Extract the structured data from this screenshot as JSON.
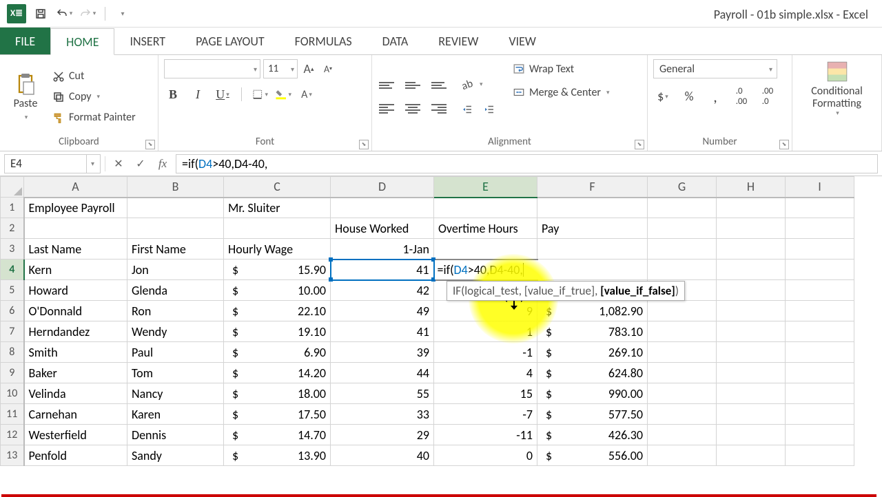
{
  "window_title": "Payroll - 01b simple.xlsx - Excel",
  "qat": {
    "excel": "X≣"
  },
  "tabs": {
    "file": "FILE",
    "home": "HOME",
    "insert": "INSERT",
    "page_layout": "PAGE LAYOUT",
    "formulas": "FORMULAS",
    "data": "DATA",
    "review": "REVIEW",
    "view": "VIEW"
  },
  "ribbon": {
    "clipboard": {
      "label": "Clipboard",
      "paste": "Paste",
      "cut": "Cut",
      "copy": "Copy",
      "format_painter": "Format Painter"
    },
    "font": {
      "label": "Font",
      "size": "11"
    },
    "alignment": {
      "label": "Alignment",
      "wrap": "Wrap Text",
      "merge": "Merge & Center"
    },
    "number": {
      "label": "Number",
      "format": "General"
    },
    "cond": "Conditional Formatting"
  },
  "name_box": "E4",
  "formula_prefix": "=if(",
  "formula_ref": "D4",
  "formula_rest": ">40,D4-40,",
  "tooltip": {
    "fn": "IF",
    "a1": "logical_test",
    "a2": "[value_if_true]",
    "a3": "[value_if_false]"
  },
  "columns": [
    "A",
    "B",
    "C",
    "D",
    "E",
    "F",
    "G",
    "H",
    "I"
  ],
  "headers": {
    "r1": {
      "A": "Employee Payroll",
      "C": "Mr. Sluiter"
    },
    "r2": {
      "D": "House Worked",
      "E": "Overtime Hours",
      "F": "Pay"
    },
    "r3": {
      "A": "Last Name",
      "B": "First Name",
      "C": "Hourly Wage",
      "D": "1-Jan"
    }
  },
  "rows": [
    {
      "n": 4,
      "last": "Kern",
      "first": "Jon",
      "wage": "15.90",
      "hours": "41",
      "ot": "",
      "pay": ""
    },
    {
      "n": 5,
      "last": "Howard",
      "first": "Glenda",
      "wage": "10.00",
      "hours": "42",
      "ot": "",
      "pay": ""
    },
    {
      "n": 6,
      "last": "O'Donnald",
      "first": "Ron",
      "wage": "22.10",
      "hours": "49",
      "ot": "9",
      "pay": "1,082.90"
    },
    {
      "n": 7,
      "last": "Herndandez",
      "first": "Wendy",
      "wage": "19.10",
      "hours": "41",
      "ot": "1",
      "pay": "783.10"
    },
    {
      "n": 8,
      "last": "Smith",
      "first": "Paul",
      "wage": "6.90",
      "hours": "39",
      "ot": "-1",
      "pay": "269.10"
    },
    {
      "n": 9,
      "last": "Baker",
      "first": "Tom",
      "wage": "14.20",
      "hours": "44",
      "ot": "4",
      "pay": "624.80"
    },
    {
      "n": 10,
      "last": "Velinda",
      "first": "Nancy",
      "wage": "18.00",
      "hours": "55",
      "ot": "15",
      "pay": "990.00"
    },
    {
      "n": 11,
      "last": "Carnehan",
      "first": "Karen",
      "wage": "17.50",
      "hours": "33",
      "ot": "-7",
      "pay": "577.50"
    },
    {
      "n": 12,
      "last": "Westerfield",
      "first": "Dennis",
      "wage": "14.70",
      "hours": "29",
      "ot": "-11",
      "pay": "426.30"
    },
    {
      "n": 13,
      "last": "Penfold",
      "first": "Sandy",
      "wage": "13.90",
      "hours": "40",
      "ot": "0",
      "pay": "556.00"
    }
  ]
}
